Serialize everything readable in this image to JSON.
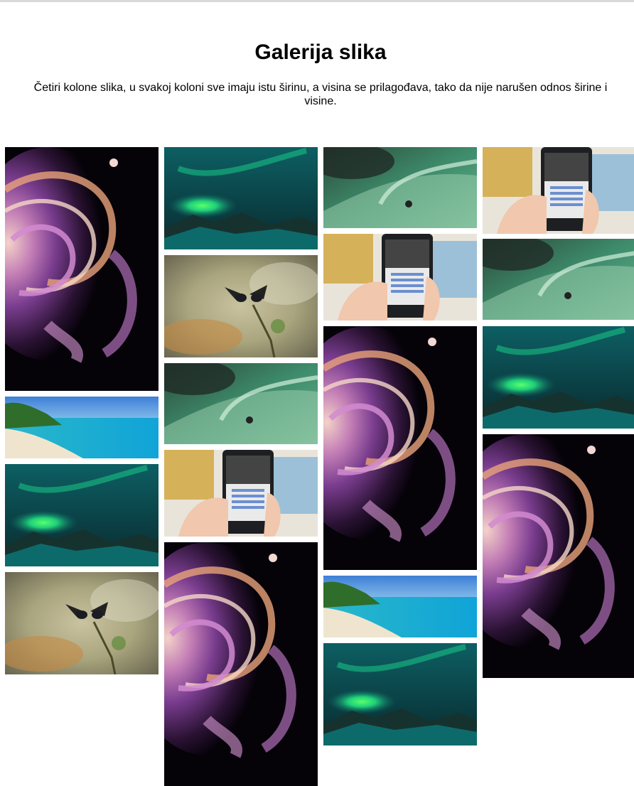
{
  "page": {
    "title": "Galerija slika",
    "description": "Četiri kolone slika, u svakoj koloni sve imaju istu širinu, a visina se prilagođava, tako da nije narušen odnos širine i visine."
  },
  "gallery": {
    "columns": [
      [
        "swirl",
        "beach",
        "aurora",
        "birds"
      ],
      [
        "aurora",
        "birds",
        "wave",
        "phone",
        "swirl"
      ],
      [
        "wave",
        "phone",
        "swirl",
        "beach",
        "aurora"
      ],
      [
        "phone",
        "wave",
        "aurora",
        "swirl"
      ]
    ]
  }
}
